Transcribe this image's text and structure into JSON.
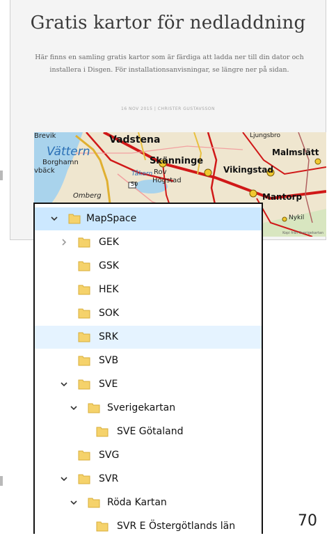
{
  "web_page": {
    "title": "Gratis kartor för nedladdning",
    "intro": "Här finns en samling gratis kartor som är färdiga att ladda ner till din dator och installera i Disgen. För installationsanvisningar, se längre ner på sidan.",
    "meta": "16 NOV 2015 | CHRISTER GUSTAVSSON",
    "map": {
      "labels": [
        "Brevik",
        "Vättern",
        "Borghamn",
        "vbäck",
        "Vadstena",
        "Skänninge",
        "Rov",
        "Högstad",
        "Tåkern",
        "Omberg",
        "Vikingstad",
        "Malmslätt",
        "Mantorp",
        "Nykil",
        "Ljungsbro",
        "50"
      ],
      "credit": "Kopi från Sverigekartan"
    }
  },
  "tree": {
    "items": [
      {
        "label": "MapSpace",
        "chevron": "expanded"
      },
      {
        "label": "GEK",
        "chevron": "collapsed"
      },
      {
        "label": "GSK",
        "chevron": "none"
      },
      {
        "label": "HEK",
        "chevron": "none"
      },
      {
        "label": "SOK",
        "chevron": "none"
      },
      {
        "label": "SRK",
        "chevron": "none"
      },
      {
        "label": "SVB",
        "chevron": "none"
      },
      {
        "label": "SVE",
        "chevron": "expanded"
      },
      {
        "label": "Sverigekartan",
        "chevron": "expanded"
      },
      {
        "label": "SVE Götaland",
        "chevron": "none"
      },
      {
        "label": "SVG",
        "chevron": "none"
      },
      {
        "label": "SVR",
        "chevron": "expanded"
      },
      {
        "label": "Röda Kartan",
        "chevron": "expanded"
      },
      {
        "label": "SVR E Östergötlands län",
        "chevron": "none"
      }
    ],
    "colors": {
      "selected_bg": "#cce8ff",
      "hover_bg": "#e5f3ff",
      "folder": "#f5d26b"
    }
  },
  "page_number": "70"
}
